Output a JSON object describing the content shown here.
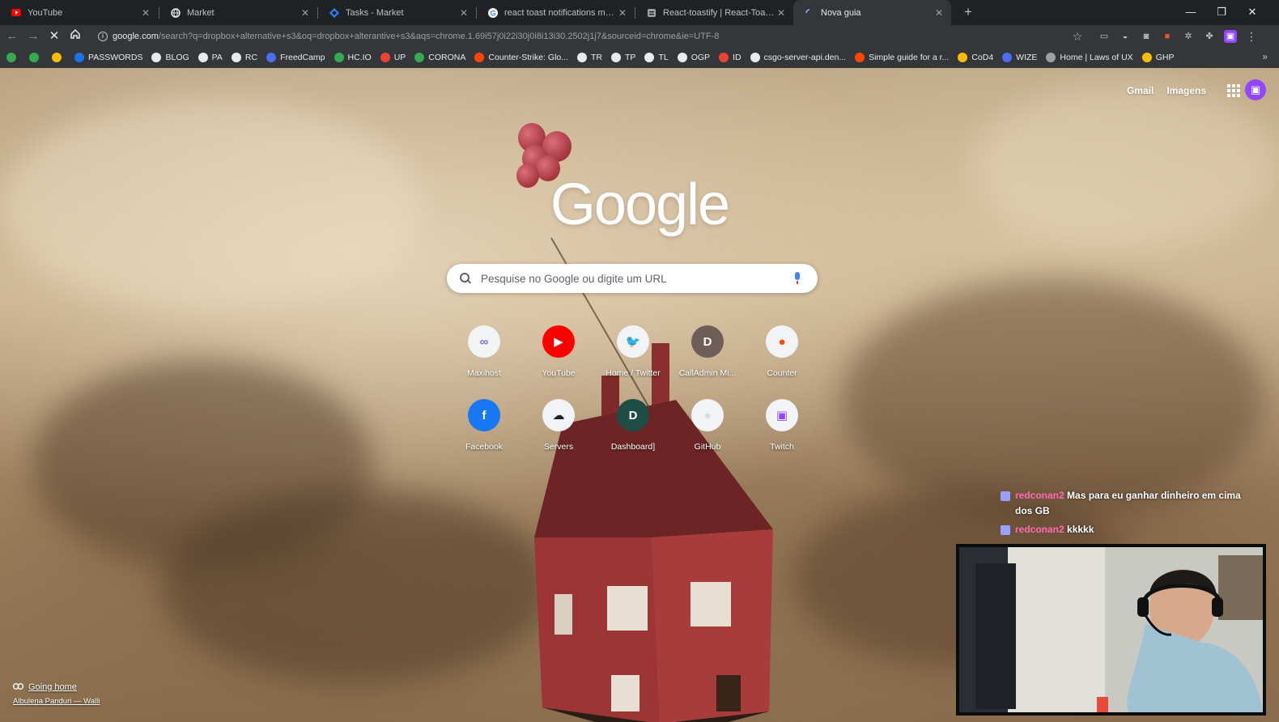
{
  "tabs": [
    {
      "title": "YouTube",
      "icon": "youtube-icon",
      "active": false
    },
    {
      "title": "Market",
      "icon": "globe-icon",
      "active": false
    },
    {
      "title": "Tasks - Market",
      "icon": "jira-icon",
      "active": false
    },
    {
      "title": "react toast notifications mobile -",
      "icon": "google-icon",
      "active": false
    },
    {
      "title": "React-toastify | React-Toastify",
      "icon": "docs-icon",
      "active": false
    },
    {
      "title": "Nova guia",
      "icon": "loading-icon",
      "active": true
    }
  ],
  "toolbar": {
    "url_host": "google.com",
    "url_rest": "/search?q=dropbox+alternative+s3&oq=dropbox+alterantive+s3&aqs=chrome.1.69i57j0i22i30j0i8i13i30.2502j1j7&sourceid=chrome&ie=UTF-8"
  },
  "bookmarks": [
    {
      "label": "",
      "color": "#34a853"
    },
    {
      "label": "",
      "color": "#34a853"
    },
    {
      "label": "",
      "color": "#fbbc04"
    },
    {
      "label": "PASSWORDS",
      "color": "#1a73e8"
    },
    {
      "label": "BLOG",
      "color": "#e8eaed"
    },
    {
      "label": "PA",
      "color": "#e8eaed"
    },
    {
      "label": "RC",
      "color": "#e8eaed"
    },
    {
      "label": "FreedCamp",
      "color": "#4c6ef5"
    },
    {
      "label": "HC.IO",
      "color": "#34a853"
    },
    {
      "label": "UP",
      "color": "#ea4335"
    },
    {
      "label": "CORONA",
      "color": "#34a853"
    },
    {
      "label": "Counter-Strike: Glo...",
      "color": "#ff4500"
    },
    {
      "label": "TR",
      "color": "#e8eaed"
    },
    {
      "label": "TP",
      "color": "#e8eaed"
    },
    {
      "label": "TL",
      "color": "#e8eaed"
    },
    {
      "label": "OGP",
      "color": "#e8eaed"
    },
    {
      "label": "ID",
      "color": "#ea4335"
    },
    {
      "label": "csgo-server-api.den...",
      "color": "#e8eaed"
    },
    {
      "label": "Simple guide for a r...",
      "color": "#ff4500"
    },
    {
      "label": "CoD4",
      "color": "#fbbc04"
    },
    {
      "label": "WIZE",
      "color": "#4c6ef5"
    },
    {
      "label": "Home | Laws of UX",
      "color": "#9aa0a6"
    },
    {
      "label": "GHP",
      "color": "#fbbc04"
    }
  ],
  "page": {
    "gmail": "Gmail",
    "images": "Imagens",
    "logo": "Google",
    "search_placeholder": "Pesquise no Google ou digite um URL",
    "shortcuts": [
      {
        "label": "Maxihost",
        "glyph": "∞",
        "color": "#7b6cf6",
        "bg": "#f1f3f4"
      },
      {
        "label": "YouTube",
        "glyph": "▶",
        "color": "#ffffff",
        "bg": "#ff0000"
      },
      {
        "label": "Home / Twitter",
        "glyph": "🐦",
        "color": "#1da1f2",
        "bg": "#f1f3f4"
      },
      {
        "label": "CallAdmin Mi...",
        "glyph": "D",
        "color": "#ffffff",
        "bg": "#6d5f58"
      },
      {
        "label": "Counter",
        "glyph": "●",
        "color": "#ff4500",
        "bg": "#f1f3f4"
      },
      {
        "label": "Facebook",
        "glyph": "f",
        "color": "#ffffff",
        "bg": "#1877f2"
      },
      {
        "label": "Servers",
        "glyph": "☁",
        "color": "#202124",
        "bg": "#f1f3f4"
      },
      {
        "label": "Dashboard]",
        "glyph": "D",
        "color": "#ffffff",
        "bg": "#1e4d45"
      },
      {
        "label": "GitHub",
        "glyph": "●",
        "color": "#dcdcdc",
        "bg": "#f1f3f4"
      },
      {
        "label": "Twitch",
        "glyph": "▣",
        "color": "#9147ff",
        "bg": "#f1f3f4"
      }
    ],
    "attribution_title": "Going home",
    "attribution_author": "Albulena Panduri — Walli"
  },
  "chat": [
    {
      "user": "redconan2",
      "message": "Mas para eu ganhar dinheiro em cima dos GB"
    },
    {
      "user": "redconan2",
      "message": "kkkkk"
    }
  ],
  "colors": {
    "accent": "#8ab4f8",
    "tab_bg": "#202124",
    "toolbar_bg": "#35363a",
    "twitch": "#9147ff"
  }
}
